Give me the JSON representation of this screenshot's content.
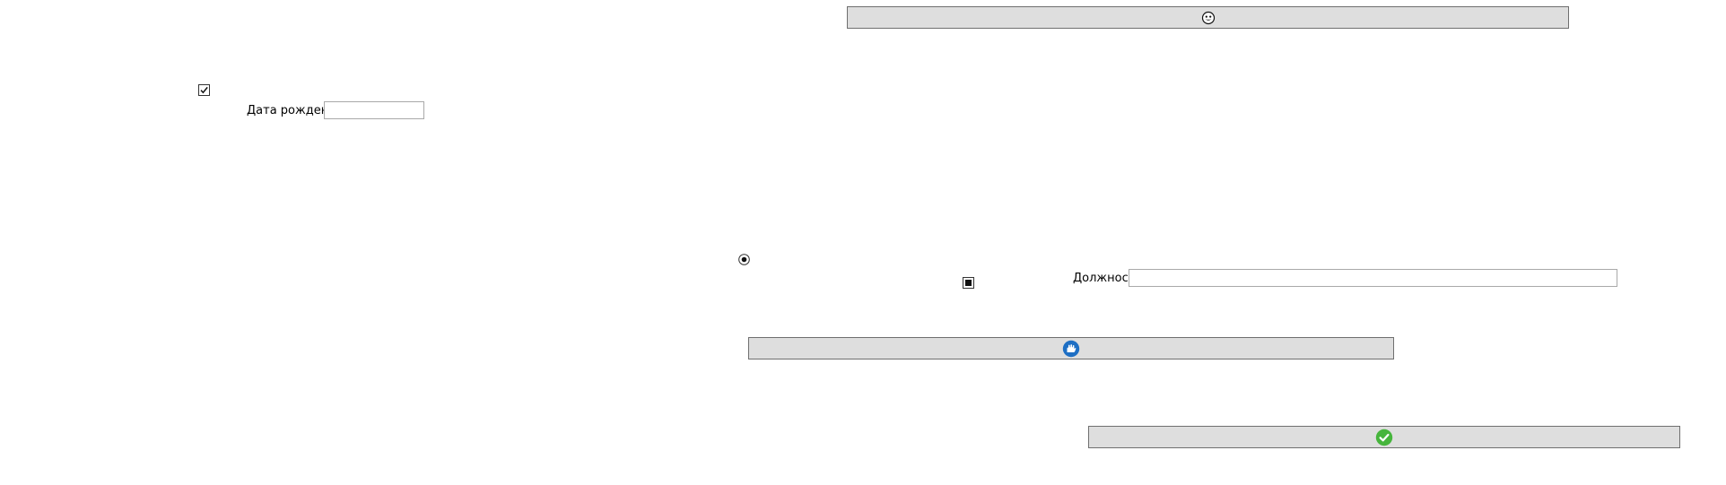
{
  "top_button": {
    "icon": "smiley-face-icon"
  },
  "birthdate_checkbox": {
    "icon": "checkmark-icon",
    "checked": true
  },
  "birthdate": {
    "label": "Дата рождения",
    "value": ""
  },
  "radio": {
    "icon": "radio-selected-icon",
    "selected": true
  },
  "indeterminate_checkbox": {
    "icon": "square-indeterminate-icon",
    "state": "indeterminate"
  },
  "position": {
    "label": "Должность",
    "value": ""
  },
  "middle_button": {
    "icon": "blue-circle-hand-icon",
    "accent": "#1e6fc4"
  },
  "bottom_button": {
    "icon": "green-check-circle-icon",
    "accent": "#46b53c"
  },
  "colors": {
    "button_bg": "#dedede",
    "button_border": "#6f6f6f",
    "field_border": "#a9a9a9"
  }
}
